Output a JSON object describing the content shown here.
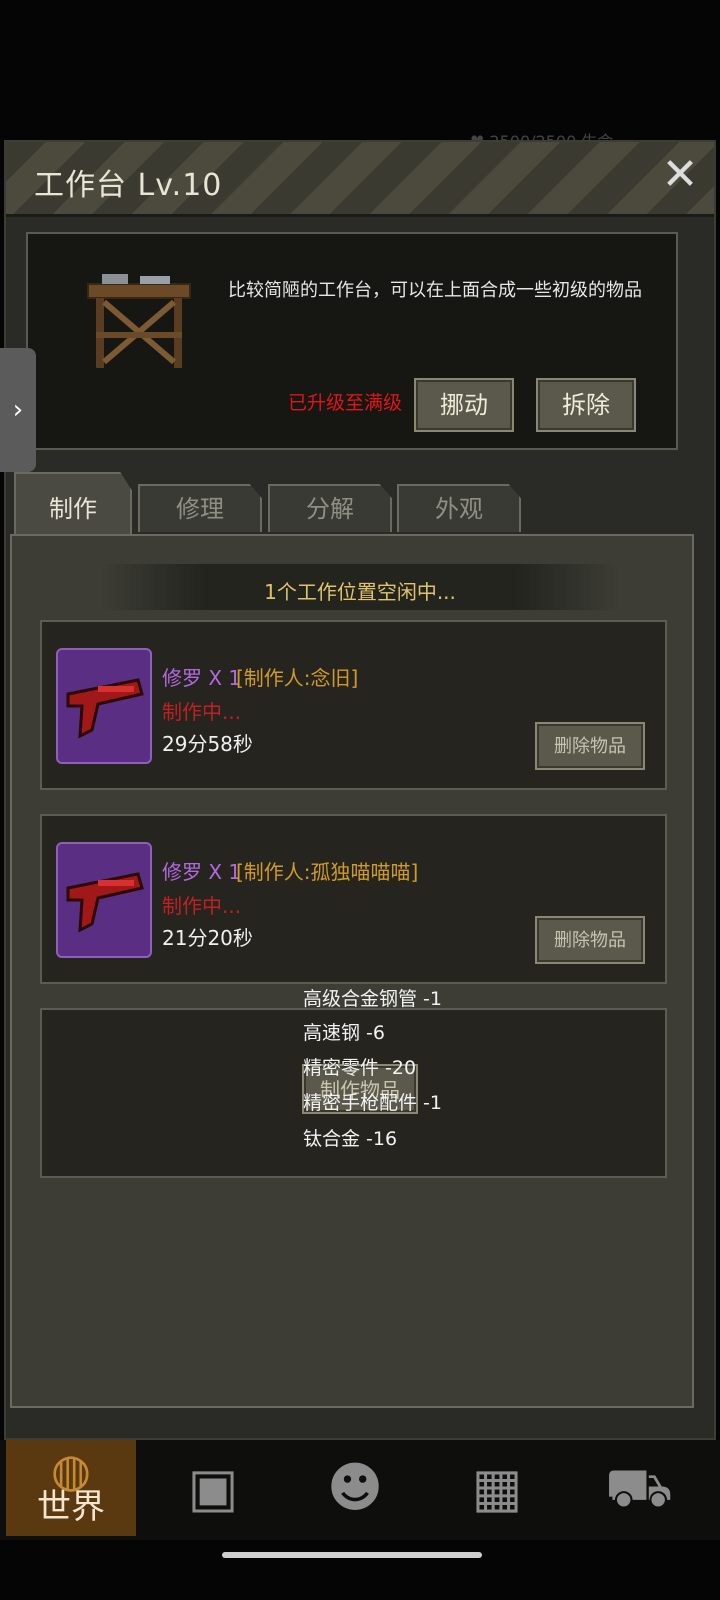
{
  "hud_text": "♥ 2500/2500   生命",
  "panel": {
    "title": "工作台 Lv.10",
    "close_label": "✕",
    "description": "比较简陋的工作台，可以在上面合成一些初级的物品",
    "status_maxed": "已升级至满级",
    "move_label": "挪动",
    "demolish_label": "拆除"
  },
  "side_handle": "›",
  "tabs": [
    {
      "label": "制作",
      "active": true
    },
    {
      "label": "修理"
    },
    {
      "label": "分解"
    },
    {
      "label": "外观"
    }
  ],
  "craft": {
    "slot_status": "1个工作位置空闲中...",
    "jobs": [
      {
        "item": "修罗 X 1",
        "maker": "[制作人:念旧]",
        "state": "制作中...",
        "time": "29分58秒",
        "delete_label": "删除物品"
      },
      {
        "item": "修罗 X 1",
        "maker": "[制作人:孤独喵喵喵]",
        "state": "制作中...",
        "time": "21分20秒",
        "delete_label": "删除物品"
      }
    ],
    "craft_button": "制作物品",
    "materials": [
      "高级合金钢管 -1",
      "高速钢 -6",
      "精密零件 -20",
      "精密手枪配件 -1",
      "钛合金 -16"
    ]
  },
  "bottom_nav": [
    {
      "label": "世界",
      "icon": "globe-icon"
    },
    {
      "icon": "backpack-icon"
    },
    {
      "icon": "head-icon"
    },
    {
      "icon": "building-icon"
    },
    {
      "icon": "cart-icon"
    }
  ],
  "colors": {
    "maxed": "#e01515",
    "item_name": "#b468e0",
    "maker": "#d09a2a",
    "crafting": "#c12020",
    "status": "#e3c36a"
  }
}
